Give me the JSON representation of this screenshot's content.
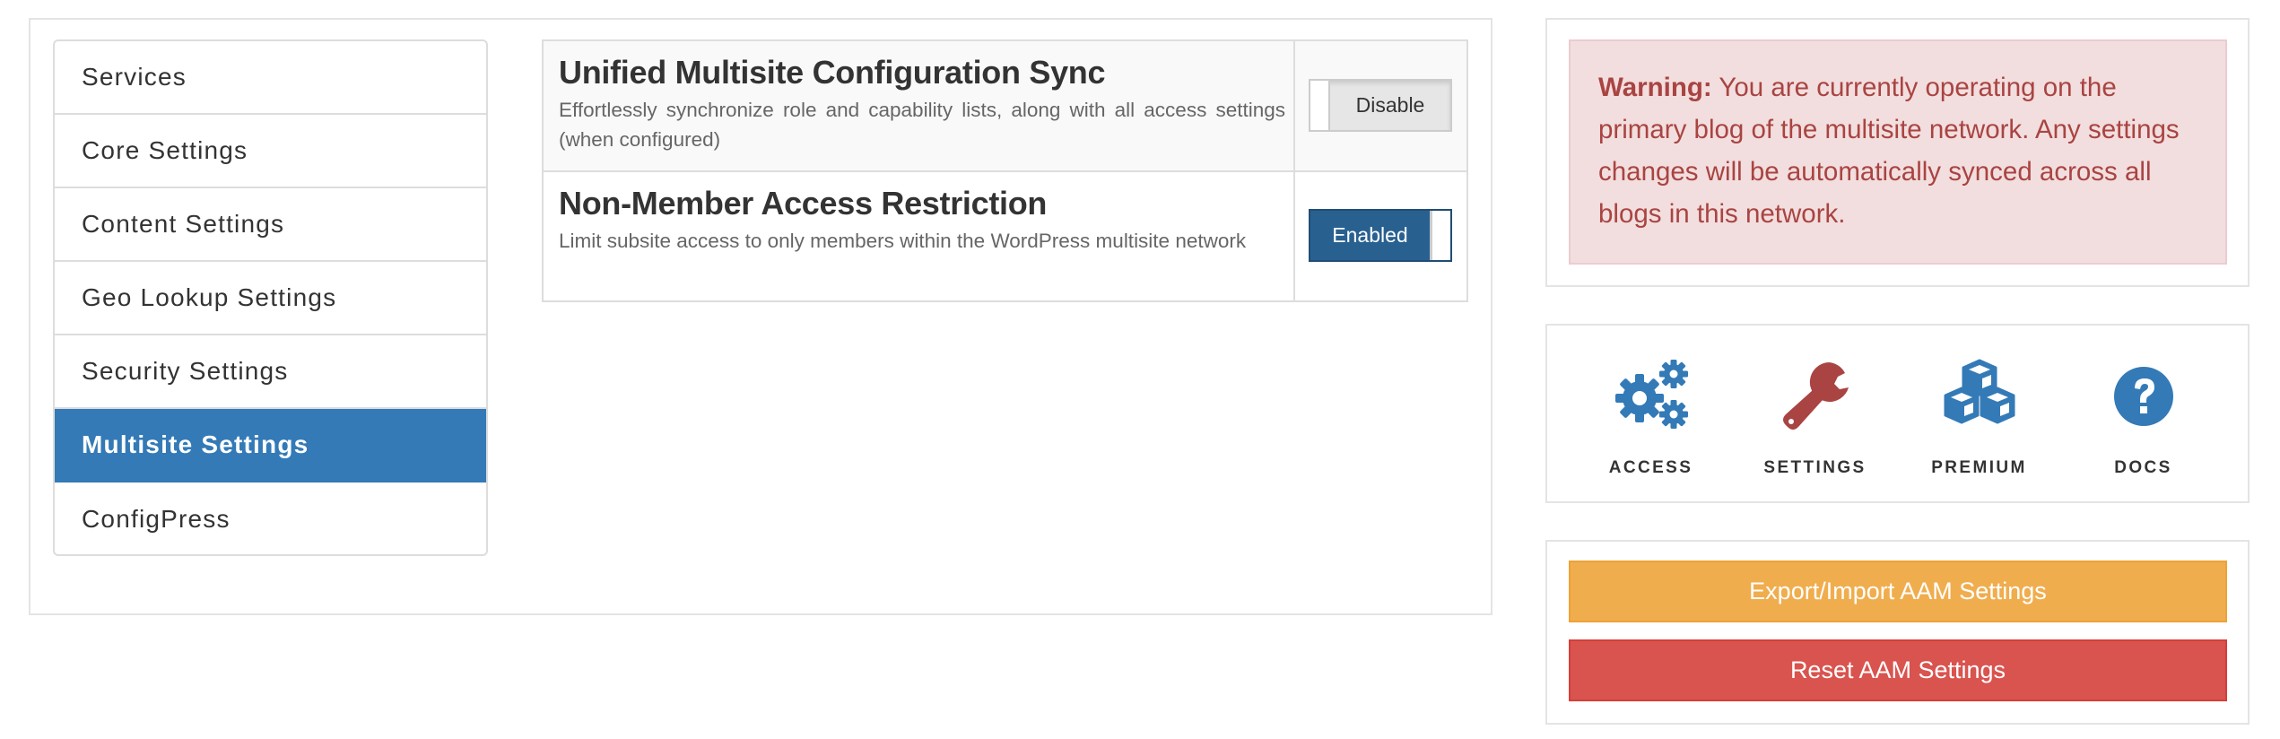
{
  "sidebar": {
    "items": [
      {
        "label": "Services",
        "active": false
      },
      {
        "label": "Core Settings",
        "active": false
      },
      {
        "label": "Content Settings",
        "active": false
      },
      {
        "label": "Geo Lookup Settings",
        "active": false
      },
      {
        "label": "Security Settings",
        "active": false
      },
      {
        "label": "Multisite Settings",
        "active": true
      },
      {
        "label": "ConfigPress",
        "active": false
      }
    ]
  },
  "settings": [
    {
      "title": "Unified Multisite Configuration Sync",
      "description": "Effortlessly synchronize role and capability lists, along with all access settings (when configured)",
      "toggle_label": "Disable",
      "enabled": false
    },
    {
      "title": "Non-Member Access Restriction",
      "description": "Limit subsite access to only members within the WordPress multisite network",
      "toggle_label": "Enabled",
      "enabled": true
    }
  ],
  "warning": {
    "prefix": "Warning:",
    "text": " You are currently operating on the primary blog of the multisite network. Any settings changes will be automatically synced across all blogs in this network."
  },
  "nav": [
    {
      "label": "ACCESS",
      "icon": "gears-icon",
      "color": "#337ab7"
    },
    {
      "label": "SETTINGS",
      "icon": "wrench-icon",
      "color": "#a94442"
    },
    {
      "label": "PREMIUM",
      "icon": "cubes-icon",
      "color": "#337ab7"
    },
    {
      "label": "DOCS",
      "icon": "question-circle-icon",
      "color": "#337ab7"
    }
  ],
  "actions": {
    "export_label": "Export/Import AAM Settings",
    "reset_label": "Reset AAM Settings"
  },
  "colors": {
    "primary": "#337ab7",
    "toggle_on": "#286090",
    "warning_bg": "#f2dede",
    "warning_text": "#a94442",
    "export_btn": "#f0ad4e",
    "reset_btn": "#d9534f"
  }
}
